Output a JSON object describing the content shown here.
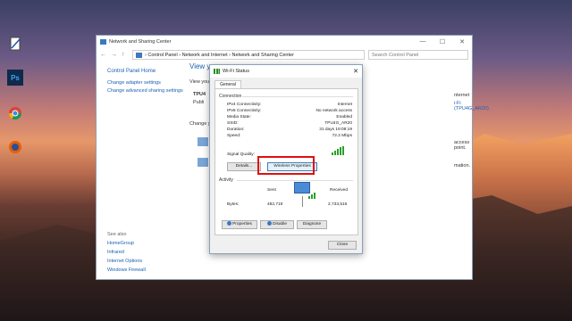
{
  "desktop": {
    "icons": [
      "notepad-icon",
      "photoshop-icon",
      "chrome-icon",
      "firefox-icon"
    ],
    "ps_label": "Ps"
  },
  "window": {
    "title": "Network and Sharing Center",
    "controls": [
      "—",
      "☐",
      "✕"
    ],
    "address": "› Control Panel › Network and Internet › Network and Sharing Center",
    "search_placeholder": "Search Control Panel",
    "left": {
      "home": "Control Panel Home",
      "links": [
        "Change adapter settings",
        "Change advanced sharing settings"
      ]
    },
    "see_also": {
      "header": "See also",
      "links": [
        "HomeGroup",
        "Infrared",
        "Internet Options",
        "Windows Firewall"
      ]
    },
    "main": {
      "view_title": "View y",
      "view_sub": "View you",
      "network_name": "TPU4",
      "network_type": "Publi",
      "change_label": "Change y",
      "right_text1": "nternet",
      "right_link": "i-Fi (TPU4G_AR20)",
      "right_text2": "access point.",
      "right_text3": "mation."
    }
  },
  "dialog": {
    "title": "Wi-Fi Status",
    "close": "✕",
    "tab": "General",
    "connection_header": "Connection",
    "connection": [
      {
        "label": "IPv4 Connectivity:",
        "value": "Internet"
      },
      {
        "label": "IPv6 Connectivity:",
        "value": "No network access"
      },
      {
        "label": "Media State:",
        "value": "Enabled"
      },
      {
        "label": "SSID:",
        "value": "TPU4G_AR20"
      },
      {
        "label": "Duration:",
        "value": "31 days 19:08:19"
      },
      {
        "label": "Speed:",
        "value": "72.2 Mbps"
      }
    ],
    "signal_label": "Signal Quality:",
    "details_button": "Details...",
    "wireless_properties_button": "Wireless Properties",
    "activity_header": "Activity",
    "sent_label": "Sent",
    "received_label": "Received",
    "bytes_label": "Bytes:",
    "bytes_sent": "482,719",
    "bytes_received": "2,733,516",
    "properties_button": "Properties",
    "disable_button": "Disable",
    "diagnose_button": "Diagnose",
    "close_button": "Close"
  }
}
